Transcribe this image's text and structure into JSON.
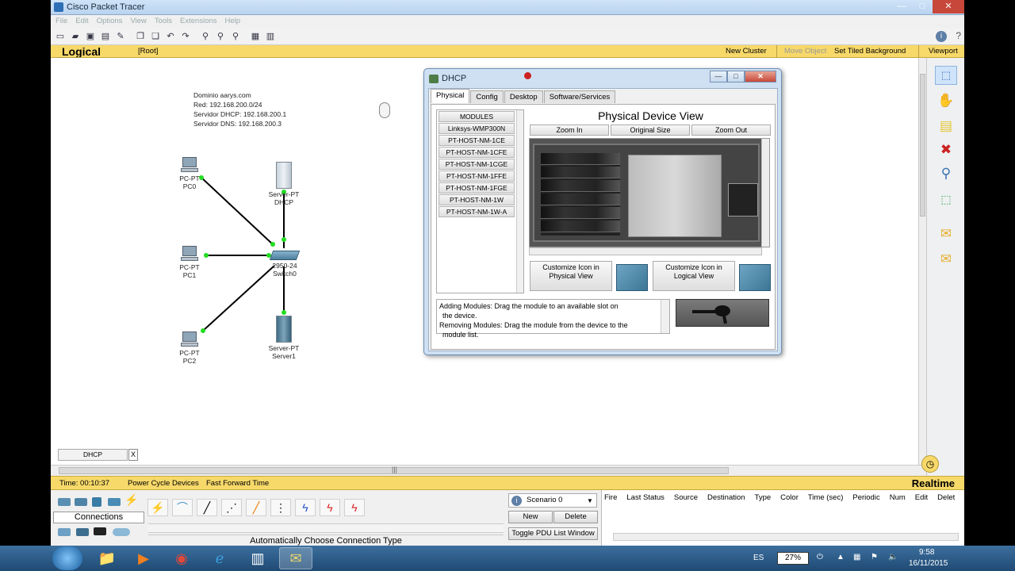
{
  "window": {
    "title": "Cisco Packet Tracer",
    "controls": {
      "minimize": "—",
      "maximize": "□",
      "close": "✕"
    }
  },
  "menu": [
    "File",
    "Edit",
    "Options",
    "View",
    "Tools",
    "Extensions",
    "Help"
  ],
  "logical_bar": {
    "label": "Logical",
    "root": "[Root]",
    "new_cluster": "New Cluster",
    "move_object": "Move Object",
    "set_tiled_background": "Set Tiled Background",
    "viewport": "Viewport"
  },
  "network_info": {
    "line1": "Dominio aarys.com",
    "line2": "Red: 192.168.200.0/24",
    "line3": "Servidor DHCP: 192.168.200.1",
    "line4": "Servidor DNS: 192.168.200.3"
  },
  "devices": {
    "pc0": {
      "type": "PC-PT",
      "name": "PC0"
    },
    "pc1": {
      "type": "PC-PT",
      "name": "PC1"
    },
    "pc2": {
      "type": "PC-PT",
      "name": "PC2"
    },
    "dhcp": {
      "type": "Server-PT",
      "name": "DHCP"
    },
    "server1": {
      "type": "Server-PT",
      "name": "Server1"
    },
    "switch": {
      "type": "2950-24",
      "name": "Switch0"
    }
  },
  "workspace_tab": {
    "label": "DHCP",
    "close": "X"
  },
  "timebar": {
    "time": "Time: 00:10:37",
    "power_cycle": "Power Cycle Devices",
    "fast_forward": "Fast Forward Time",
    "mode": "Realtime"
  },
  "connections": {
    "label": "Connections",
    "status": "Automatically Choose Connection Type"
  },
  "scenario": {
    "selected": "Scenario 0",
    "new": "New",
    "delete": "Delete",
    "toggle": "Toggle PDU List Window"
  },
  "pdu_columns": [
    "Fire",
    "Last Status",
    "Source",
    "Destination",
    "Type",
    "Color",
    "Time (sec)",
    "Periodic",
    "Num",
    "Edit",
    "Delet"
  ],
  "dialog": {
    "title": "DHCP",
    "tabs": [
      "Physical",
      "Config",
      "Desktop",
      "Software/Services"
    ],
    "modules_header": "MODULES",
    "modules": [
      "Linksys-WMP300N",
      "PT-HOST-NM-1CE",
      "PT-HOST-NM-1CFE",
      "PT-HOST-NM-1CGE",
      "PT-HOST-NM-1FFE",
      "PT-HOST-NM-1FGE",
      "PT-HOST-NM-1W",
      "PT-HOST-NM-1W-A"
    ],
    "view_title": "Physical Device View",
    "zoom_in": "Zoom In",
    "original_size": "Original Size",
    "zoom_out": "Zoom Out",
    "customize_physical": "Customize Icon in Physical View",
    "customize_logical": "Customize Icon in Logical View",
    "help_line1": "Adding Modules: Drag the module to an available slot on",
    "help_line2": "the device.",
    "help_line3": "Removing Modules: Drag the module from the device to the",
    "help_line4": "module list."
  },
  "taskbar": {
    "lang": "ES",
    "battery": "27%",
    "time": "9:58",
    "date": "16/11/2015"
  },
  "colors": {
    "accent_yellow": "#f7d96a",
    "link_green": "#22dd22",
    "cable": "#000000"
  }
}
